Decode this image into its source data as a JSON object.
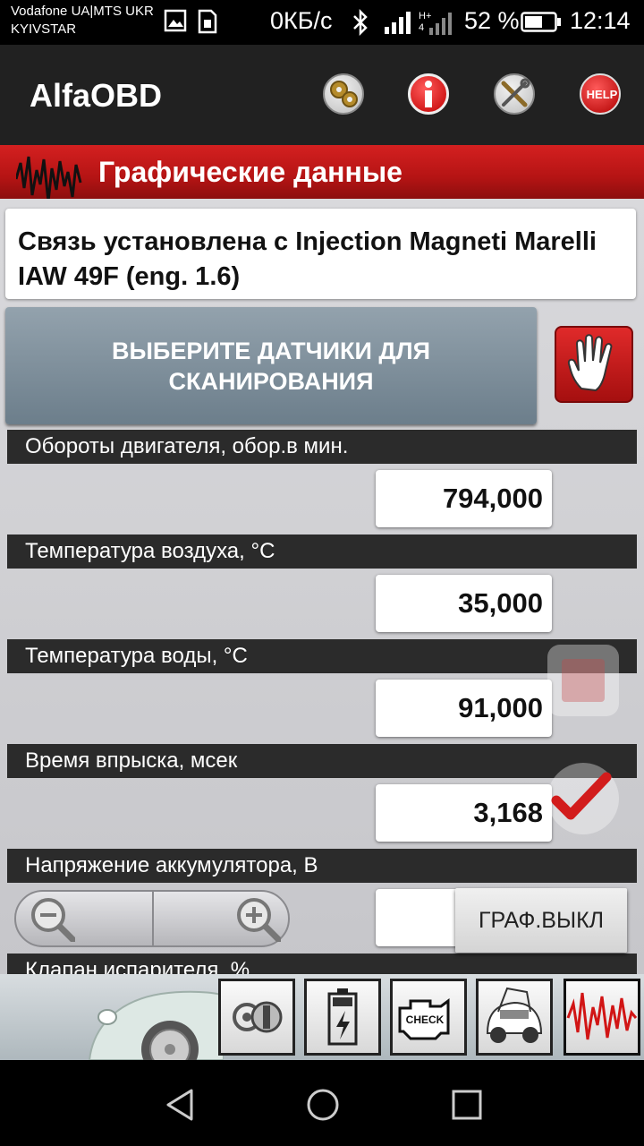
{
  "status_bar": {
    "carrier_line1": "Vodafone UA|MTS UKR",
    "carrier_line2": "KYIVSTAR",
    "net_speed": "0КБ/с",
    "battery": "52 %",
    "time": "12:14",
    "icons": [
      "image-icon",
      "sim-icon",
      "bluetooth-icon",
      "signal-icon",
      "h-plus-signal-icon",
      "battery-icon"
    ]
  },
  "app_bar": {
    "title": "AlfaOBD",
    "actions": [
      "gears-icon",
      "info-icon",
      "tools-icon",
      "help-icon"
    ],
    "help_label": "HELP"
  },
  "section": {
    "title": "Графические данные"
  },
  "connection": {
    "text": "Связь установлена с Injection Magneti Marelli IAW 49F (eng. 1.6)"
  },
  "select_sensors_button": {
    "label_line1": "ВЫБЕРИТЕ ДАТЧИКИ ДЛЯ",
    "label_line2": "СКАНИРОВАНИЯ"
  },
  "params": [
    {
      "label": "Обороты двигателя, обор.в мин.",
      "value": "794,000"
    },
    {
      "label": "Температура воздуха, °C",
      "value": "35,000"
    },
    {
      "label": "Температура воды, °C",
      "value": "91,000"
    },
    {
      "label": "Время впрыска, мсек",
      "value": "3,168"
    },
    {
      "label": "Напряжение аккумулятора, В",
      "value": ""
    },
    {
      "label": "Клапан испарителя, %",
      "value": ""
    }
  ],
  "graph_toggle": {
    "label": "ГРАФ.ВЫКЛ"
  },
  "bottom_tools": {
    "check_label": "CHECK",
    "items": [
      "key-icon",
      "battery-tool-icon",
      "check-engine-icon",
      "car-service-icon",
      "waveform-icon"
    ]
  },
  "colors": {
    "header_red": "#c41818",
    "app_bar": "#212121",
    "label_bar": "#2b2b2b",
    "button_gray": "#7f909c"
  }
}
